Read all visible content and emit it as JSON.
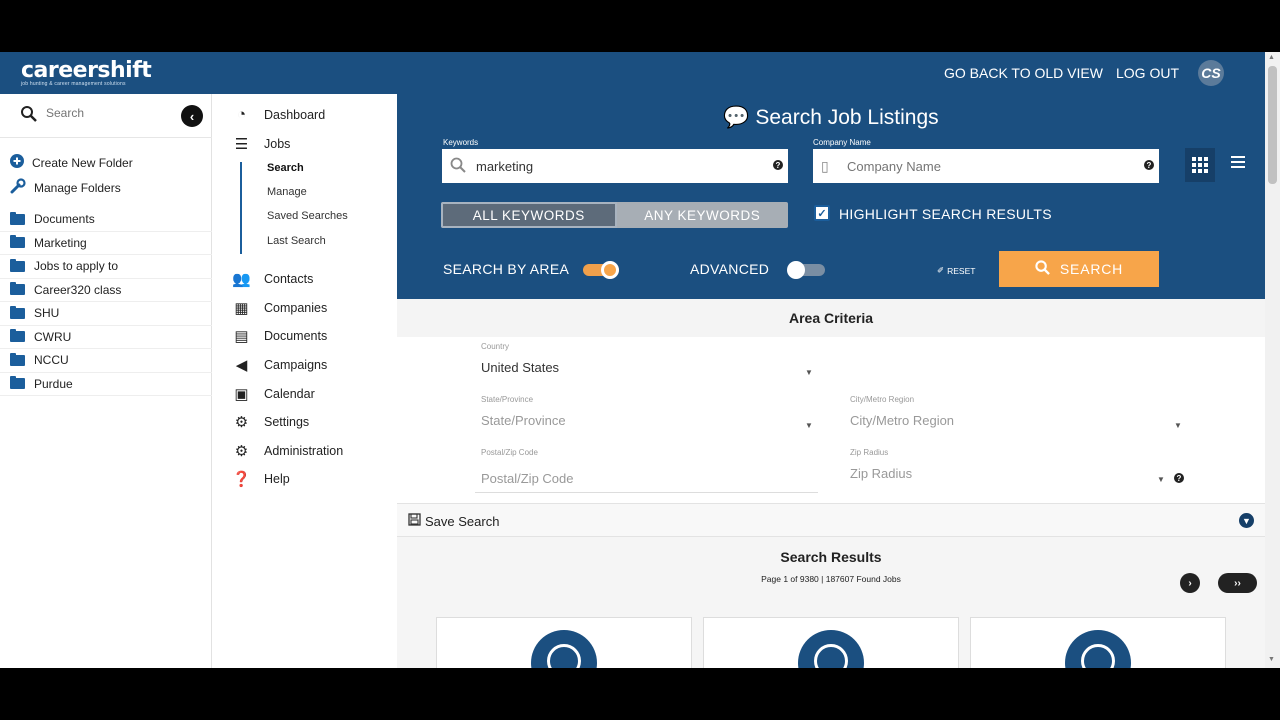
{
  "topbar": {
    "logo": "careershift",
    "logo_tagline": "job hunting & career management solutions",
    "old_view": "GO BACK TO OLD VIEW",
    "logout": "LOG OUT",
    "avatar": "CS"
  },
  "left": {
    "search_placeholder": "Search",
    "create_folder": "Create New Folder",
    "manage_folders": "Manage Folders",
    "folders": [
      "Documents",
      "Marketing",
      "Jobs to apply to",
      "Career320 class",
      "SHU",
      "CWRU",
      "NCCU",
      "Purdue"
    ]
  },
  "nav": {
    "dashboard": "Dashboard",
    "jobs": "Jobs",
    "sub": [
      "Search",
      "Manage",
      "Saved Searches",
      "Last Search"
    ],
    "contacts": "Contacts",
    "companies": "Companies",
    "documents": "Documents",
    "campaigns": "Campaigns",
    "calendar": "Calendar",
    "settings": "Settings",
    "administration": "Administration",
    "help": "Help"
  },
  "hero": {
    "title": "Search Job Listings",
    "keywords_label": "Keywords",
    "keywords_value": "marketing",
    "company_label": "Company Name",
    "company_placeholder": "Company Name",
    "all_keywords": "ALL KEYWORDS",
    "any_keywords": "ANY KEYWORDS",
    "highlight": "HIGHLIGHT SEARCH RESULTS",
    "search_by_area": "SEARCH BY AREA",
    "advanced": "ADVANCED",
    "reset": "RESET",
    "search": "SEARCH",
    "search_by_area_on": true,
    "advanced_on": false,
    "highlight_checked": true
  },
  "criteria": {
    "title": "Area Criteria",
    "country_label": "Country",
    "country_value": "United States",
    "state_label": "State/Province",
    "state_placeholder": "State/Province",
    "city_label": "City/Metro Region",
    "city_placeholder": "City/Metro Region",
    "postal_label": "Postal/Zip Code",
    "postal_placeholder": "Postal/Zip Code",
    "radius_label": "Zip Radius",
    "radius_placeholder": "Zip Radius"
  },
  "save_search": "Save Search",
  "results": {
    "title": "Search Results",
    "meta": "Page 1 of 9380 | 187607 Found Jobs"
  },
  "colors": {
    "brand_blue": "#1b4f80",
    "accent_orange": "#f7a54a"
  }
}
